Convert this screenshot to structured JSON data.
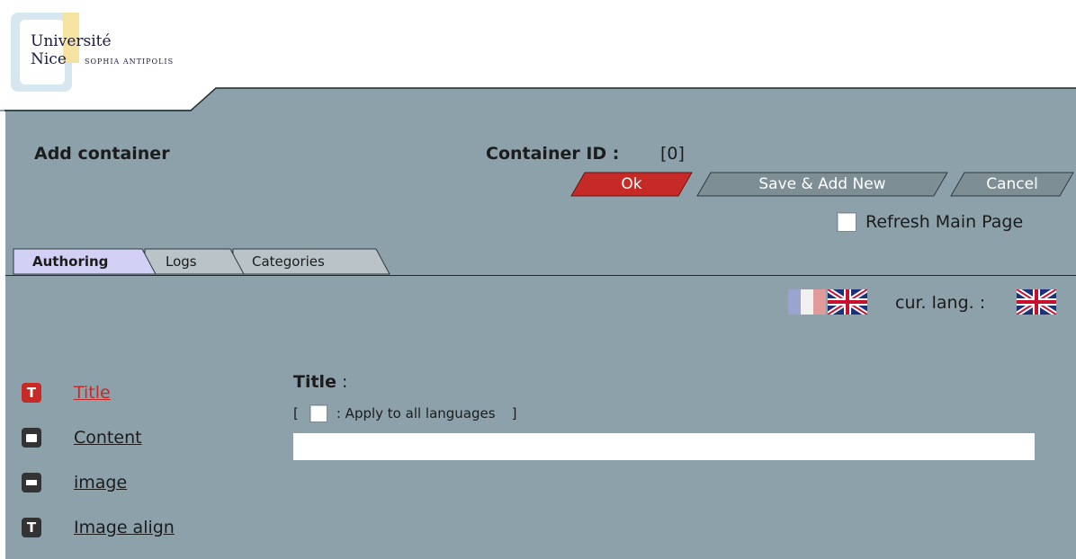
{
  "logo": {
    "line1": "Université",
    "line2": "Nice",
    "line3": "SOPHIA ANTIPOLIS"
  },
  "page": {
    "title": "Add container",
    "container_id_label": "Container ID :",
    "container_id_value": "[0]"
  },
  "buttons": {
    "ok": "Ok",
    "save_add_new": "Save & Add New",
    "cancel": "Cancel"
  },
  "refresh": {
    "label": "Refresh Main Page",
    "checked": false
  },
  "tabs": [
    {
      "label": "Authoring",
      "active": true
    },
    {
      "label": "Logs",
      "active": false
    },
    {
      "label": "Categories",
      "active": false
    }
  ],
  "language": {
    "available": [
      "fr",
      "en"
    ],
    "current_label": "cur. lang. :",
    "current": "en"
  },
  "nav": [
    {
      "label": "Title",
      "icon": "text-icon",
      "active": true
    },
    {
      "label": "Content",
      "icon": "content-block-icon",
      "active": false
    },
    {
      "label": "image",
      "icon": "image-block-icon",
      "active": false
    },
    {
      "label": "Image align",
      "icon": "text-icon",
      "active": false
    }
  ],
  "form": {
    "field_label": "Title",
    "field_colon": " :",
    "apply_open": "[",
    "apply_label": ": Apply to all languages",
    "apply_close": "]",
    "title_value": ""
  },
  "colors": {
    "panel": "#8da1ab",
    "ok_button": "#c62a26",
    "secondary_button": "#7e8e95",
    "active_tab": "#d2d0f4",
    "inactive_tab": "#b9c3c8",
    "active_link": "#c62a26"
  }
}
